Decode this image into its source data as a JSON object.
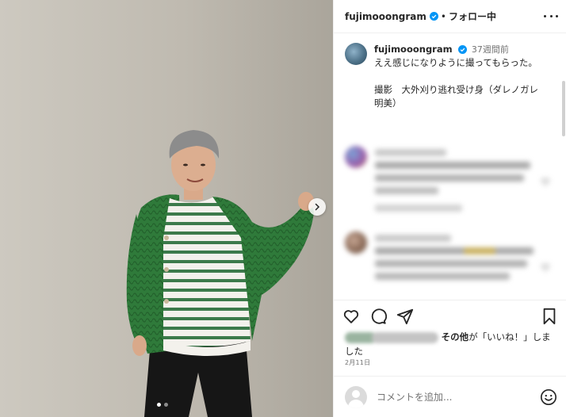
{
  "post": {
    "username": "fujimooongram",
    "separator": "•",
    "follow_label": "フォロー中",
    "time_ago": "37週間前",
    "caption": "ええ感じになりように撮ってもらった。\n\n撮影　大外刈り逃れ受け身（ダレノガレ明美）",
    "likes_suffix_strong": "その他",
    "likes_suffix": "が「いいね！」しました",
    "date": "2月11日",
    "comment_placeholder": "コメントを追加...",
    "carousel": {
      "current": 1,
      "total": 2
    }
  },
  "icons": {
    "verified": "verified-badge-icon",
    "more": "more-options-icon",
    "like": "heart-icon",
    "comment": "comment-icon",
    "share": "share-icon",
    "save": "bookmark-icon",
    "next": "chevron-right-icon",
    "emoji": "emoji-icon"
  },
  "colors": {
    "text": "#262626",
    "secondary": "#737373",
    "verified": "#0095f6",
    "divider": "#efefef"
  }
}
